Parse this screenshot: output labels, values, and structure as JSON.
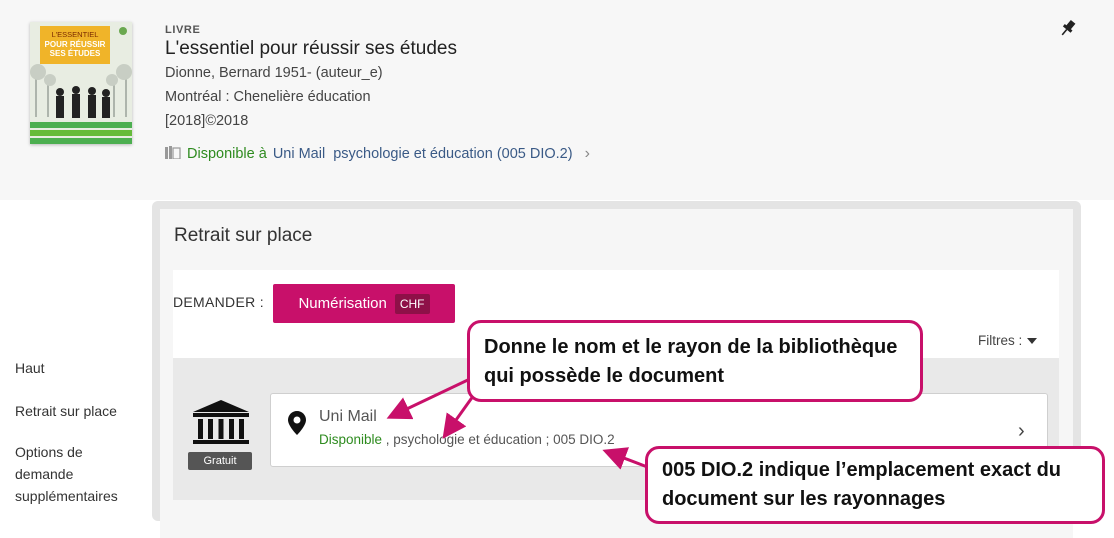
{
  "record": {
    "type": "LIVRE",
    "title": "L'essentiel pour réussir ses études",
    "author": "Dionne, Bernard 1951- (auteur_e)",
    "publisher": "Montréal : Chenelière éducation",
    "date": "[2018]©2018",
    "availability": {
      "status": "Disponible à",
      "library": "Uni Mail",
      "location": "psychologie et éducation (005 DIO.2)"
    },
    "cover": {
      "line1": "L'ESSENTIEL",
      "line2": "POUR RÉUSSIR",
      "line3": "SES ÉTUDES"
    }
  },
  "side_nav": {
    "items": [
      "Haut",
      "Retrait sur place",
      "Options de demande supplémentaires"
    ]
  },
  "panel": {
    "title": "Retrait sur place",
    "demander_label": "DEMANDER :",
    "numerisation_label": "Numérisation",
    "chf_label": "CHF",
    "filtres_label": "Filtres :"
  },
  "location": {
    "name": "Uni Mail",
    "status": "Disponible",
    "detail": " , psychologie et éducation ; 005 DIO.2",
    "badge": "Gratuit"
  },
  "callouts": {
    "first": "Donne le nom et le rayon de la bibliothèque qui possède le document",
    "second": "005 DIO.2 indique l’emplacement exact  du document sur les rayonnages"
  },
  "colors": {
    "accent": "#c8106a",
    "available": "#2e8b1f",
    "link": "#3a5a86"
  },
  "icons": [
    "pin-icon",
    "book-icon",
    "chevron-right-icon",
    "location-marker-icon",
    "library-building-icon",
    "dropdown-triangle-icon"
  ]
}
